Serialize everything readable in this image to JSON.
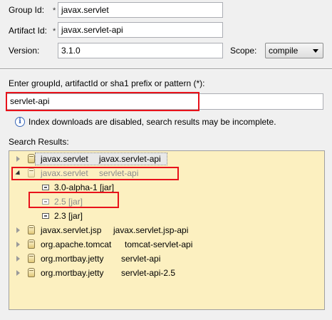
{
  "form": {
    "group_id_label": "Group Id:",
    "group_id_value": "javax.servlet",
    "artifact_id_label": "Artifact Id:",
    "artifact_id_value": "javax.servlet-api",
    "required_marker": "*",
    "version_label": "Version:",
    "version_value": "3.1.0",
    "scope_label": "Scope:",
    "scope_value": "compile"
  },
  "search": {
    "prompt_label": "Enter groupId, artifactId or sha1 prefix or pattern (*):",
    "query": "servlet-api",
    "info_icon": "i",
    "info_message": "Index downloads are disabled, search results may be incomplete.",
    "results_label": "Search Results:"
  },
  "results": [
    {
      "group": "javax.servlet",
      "artifact": "javax.servlet-api",
      "state": "collapsed",
      "dim": false
    },
    {
      "group": "javax.servlet",
      "artifact": "servlet-api",
      "state": "expanded",
      "dim": true,
      "versions": [
        {
          "label": "3.0-alpha-1 [jar]",
          "dim": false
        },
        {
          "label": "2.5 [jar]",
          "dim": true
        },
        {
          "label": "2.3 [jar]",
          "dim": false
        }
      ]
    },
    {
      "group": "javax.servlet.jsp",
      "artifact": "javax.servlet.jsp-api",
      "state": "collapsed",
      "dim": false
    },
    {
      "group": "org.apache.tomcat",
      "artifact": "tomcat-servlet-api",
      "state": "collapsed",
      "dim": false
    },
    {
      "group": "org.mortbay.jetty",
      "artifact": "servlet-api",
      "state": "collapsed",
      "dim": false
    },
    {
      "group": "org.mortbay.jetty",
      "artifact": "servlet-api-2.5",
      "state": "collapsed",
      "dim": false
    }
  ],
  "colors": {
    "highlight_box": "#e8121b",
    "results_background": "#fcf0c0"
  }
}
